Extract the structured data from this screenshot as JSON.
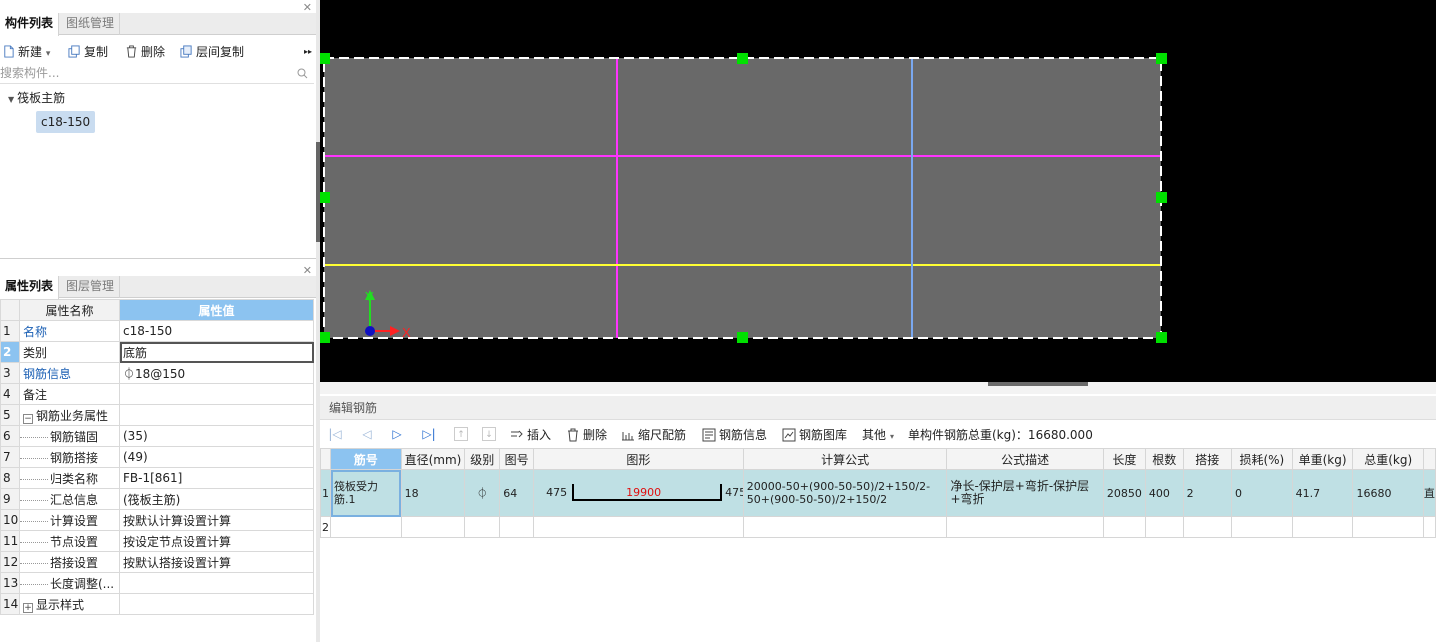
{
  "component_panel": {
    "tabs": [
      {
        "label": "构件列表",
        "active": true
      },
      {
        "label": "图纸管理",
        "active": false
      }
    ],
    "toolbar": {
      "new_label": "新建",
      "copy_label": "复制",
      "delete_label": "删除",
      "floor_copy_label": "层间复制",
      "more_label": "▸▸"
    },
    "search_placeholder": "搜索构件...",
    "tree": {
      "parent": "筏板主筋",
      "child": "c18-150"
    }
  },
  "property_panel": {
    "tabs": [
      {
        "label": "属性列表",
        "active": true
      },
      {
        "label": "图层管理",
        "active": false
      }
    ],
    "headers": {
      "name": "属性名称",
      "value": "属性值"
    },
    "rows": [
      {
        "num": "1",
        "name": "名称",
        "value": "c18-150"
      },
      {
        "num": "2",
        "name": "类别",
        "value": "底筋"
      },
      {
        "num": "3",
        "name": "钢筋信息",
        "value": "⏀18@150"
      },
      {
        "num": "4",
        "name": "备注",
        "value": ""
      },
      {
        "num": "5",
        "name": "钢筋业务属性",
        "value": "",
        "toggle": "−"
      },
      {
        "num": "6",
        "name": "钢筋锚固",
        "value": "(35)"
      },
      {
        "num": "7",
        "name": "钢筋搭接",
        "value": "(49)"
      },
      {
        "num": "8",
        "name": "归类名称",
        "value": "FB-1[861]"
      },
      {
        "num": "9",
        "name": "汇总信息",
        "value": "(筏板主筋)"
      },
      {
        "num": "10",
        "name": "计算设置",
        "value": "按默认计算设置计算"
      },
      {
        "num": "11",
        "name": "节点设置",
        "value": "按设定节点设置计算"
      },
      {
        "num": "12",
        "name": "搭接设置",
        "value": "按默认搭接设置计算"
      },
      {
        "num": "13",
        "name": "长度调整(...",
        "value": ""
      },
      {
        "num": "14",
        "name": "显示样式",
        "value": "",
        "toggle": "+"
      }
    ]
  },
  "canvas": {
    "axis_y_label": "Y",
    "axis_x_label": "X",
    "colors": {
      "background": "#000000",
      "slab": "#696969",
      "magenta": "#ff33ff",
      "yellow": "#ffff33",
      "blue_line": "#7aa8f0",
      "grip": "#00e000",
      "axis_x": "#ff2222",
      "axis_y": "#22dd22",
      "axis_origin": "#1010c0"
    }
  },
  "rebar_editor": {
    "title": "编辑钢筋",
    "toolbar": {
      "insert_label": "插入",
      "delete_label": "删除",
      "scale_label": "缩尺配筋",
      "info_label": "钢筋信息",
      "library_label": "钢筋图库",
      "other_label": "其他",
      "total_weight_label": "单构件钢筋总重(kg)：16680.000"
    },
    "columns": [
      "筋号",
      "直径(mm)",
      "级别",
      "图号",
      "图形",
      "计算公式",
      "公式描述",
      "长度",
      "根数",
      "搭接",
      "损耗(%)",
      "单重(kg)",
      "总重(kg)"
    ],
    "rows": [
      {
        "num": "1",
        "bar_no": "筏板受力筋.1",
        "diameter": "18",
        "grade": "⏀",
        "shape_no": "64",
        "shape_left": "475",
        "shape_mid": "19900",
        "shape_right": "475",
        "formula": "20000-50+(900-50-50)/2+150/2-50+(900-50-50)/2+150/2",
        "formula_desc": "净长-保护层+弯折-保护层+弯折",
        "length": "20850",
        "count": "400",
        "lap": "2",
        "loss": "0",
        "unit_weight": "41.7",
        "total_weight": "16680",
        "extra": "直"
      },
      {
        "num": "2"
      }
    ],
    "colors": {
      "selected_row": "#bfe0e4",
      "header_sel": "#8cc3f0",
      "shape_mid_text": "#e01010"
    }
  }
}
